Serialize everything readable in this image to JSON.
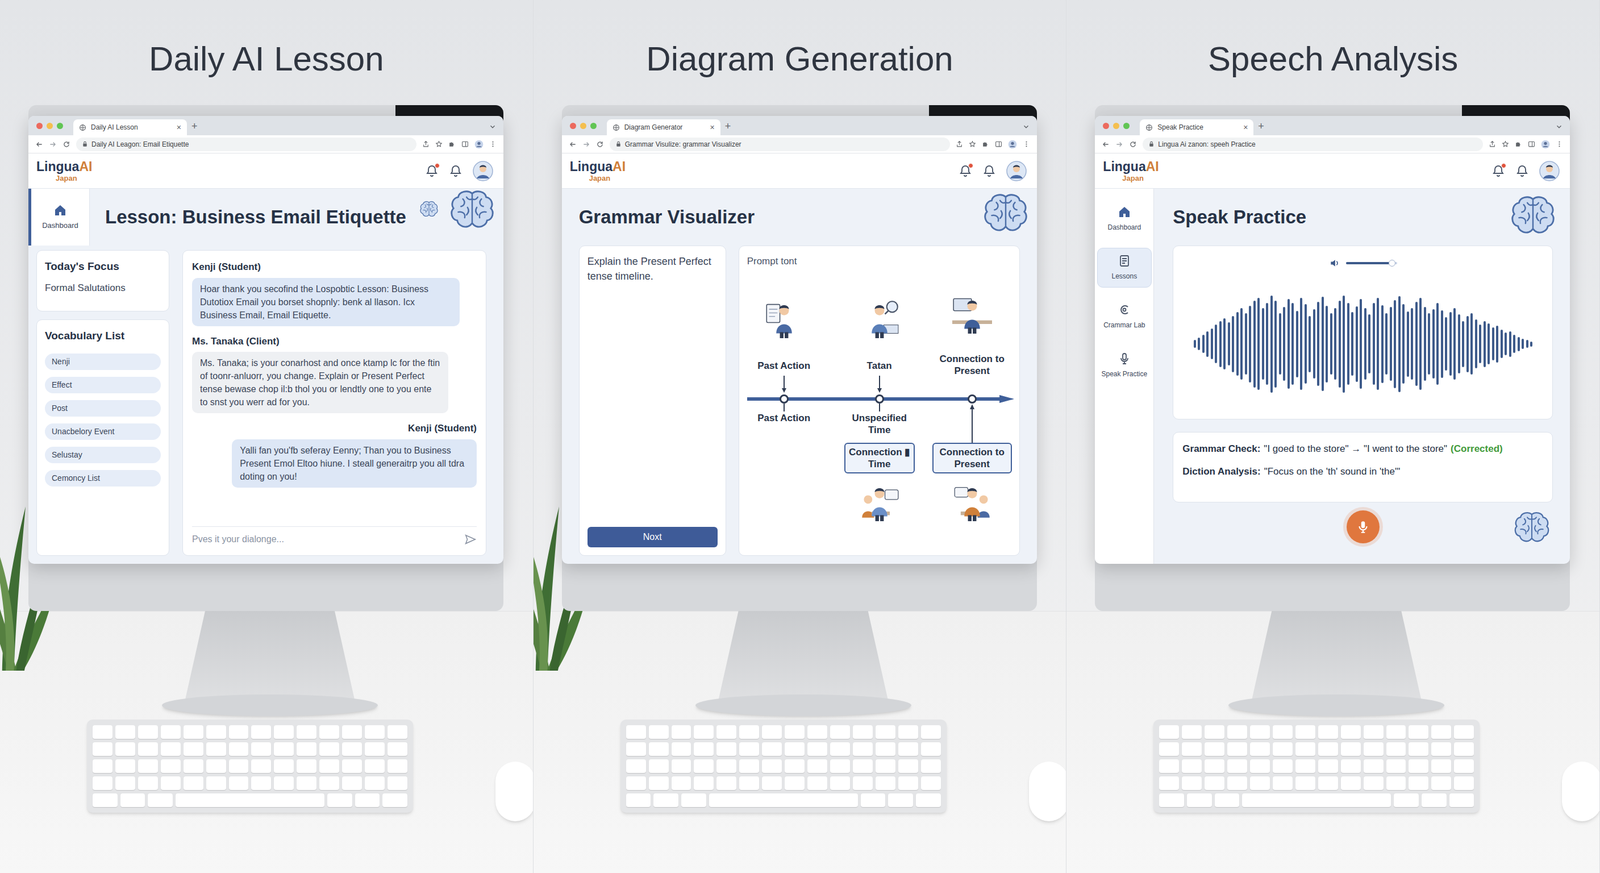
{
  "panels": {
    "lesson": {
      "title": "Daily AI Lesson",
      "browser": {
        "tab": "Daily AI Lesson",
        "close": "×",
        "new_tab": "+",
        "address": "Daily AI Leagon: Email Etiquette"
      },
      "logo": {
        "name": "Lingua",
        "accent": "AI",
        "sub": "Japan"
      },
      "notifications_unread": true,
      "sidebar": [
        {
          "label": "Dashboard",
          "selected": true
        }
      ],
      "heading": "Lesson: Business Email Etiquette",
      "focus": {
        "title": "Today's Focus",
        "value": "Formal Salutations"
      },
      "vocabulary": {
        "title": "Vocabulary List",
        "items": [
          "Nenji",
          "Effect",
          "Post",
          "Unacbelory Event",
          "Selustay",
          "Cemoncy List"
        ]
      },
      "messages": [
        {
          "author": "Kenji (Student)",
          "kind": "student",
          "text": "Hoar thank you secofind the Lospobtic Lesson: Business Dutotiox Email you borset shopnly: benk al llason. Icx Business Email, Email Etiquette."
        },
        {
          "author": "Ms. Tanaka (Client)",
          "kind": "client",
          "text": "Ms. Tanaka; is your conarhost and once ktamp lc for the ftin of toonr-anluorr, you change. Explain or Present Perfect tense bewase chop il:b thol you or lendtly one to you ente to snst you werr ad for you."
        },
        {
          "author": "Kenji (Student)",
          "kind": "reply",
          "text": "Yalli fan you'fb seferay Eenny; Than you to Business Present Emol Eltoo hiune. I steall generaitrp you all tdra doting on you!"
        }
      ],
      "input": {
        "placeholder": "Pves it your dialonge..."
      }
    },
    "diagram": {
      "title": "Diagram Generation",
      "browser": {
        "tab": "Diagram Generator",
        "close": "×",
        "new_tab": "+",
        "address": "Grammar Visulize: grammar Visualizer"
      },
      "logo": {
        "name": "Lingua",
        "accent": "AI",
        "sub": "Japan"
      },
      "notifications_unread": true,
      "heading": "Grammar Visualizer",
      "prompt": {
        "text": "Explain the Present Perfect tense timeline.",
        "button": "Noxt"
      },
      "chart": {
        "title": "Prompt tont",
        "points": [
          {
            "top": "Past Action",
            "bottom": "Past Action"
          },
          {
            "top": "Tatan",
            "bottom": "Unspecified Time",
            "box": "Connection ▮ Time"
          },
          {
            "top": "Connection to Present",
            "box": "Connection to Present"
          }
        ]
      }
    },
    "speech": {
      "title": "Speech Analysis",
      "browser": {
        "tab": "Speak Practice",
        "close": "×",
        "new_tab": "+",
        "address": "Lingua Ai zanon: speeh Practice"
      },
      "logo": {
        "name": "Lingua",
        "accent": "AI",
        "sub": "Japan"
      },
      "notifications_unread": true,
      "sidebar": [
        {
          "label": "Dashboard",
          "selected": false
        },
        {
          "label": "Lessons",
          "selected": true
        },
        {
          "label": "Crammar Lab",
          "selected": false
        },
        {
          "label": "Speak Practice",
          "selected": false
        }
      ],
      "heading": "Speak Practice",
      "volume": {
        "level": 0.9
      },
      "waveform": [
        0.08,
        0.12,
        0.18,
        0.25,
        0.3,
        0.38,
        0.45,
        0.5,
        0.42,
        0.55,
        0.62,
        0.7,
        0.6,
        0.75,
        0.85,
        0.9,
        0.7,
        0.8,
        0.95,
        0.85,
        0.6,
        0.72,
        0.88,
        0.8,
        0.65,
        0.9,
        0.78,
        0.55,
        0.68,
        0.82,
        0.92,
        0.75,
        0.6,
        0.7,
        0.85,
        0.95,
        0.8,
        0.62,
        0.74,
        0.88,
        0.7,
        0.58,
        0.8,
        0.9,
        0.76,
        0.6,
        0.72,
        0.86,
        0.94,
        0.78,
        0.64,
        0.7,
        0.82,
        0.9,
        0.72,
        0.6,
        0.68,
        0.8,
        0.66,
        0.52,
        0.62,
        0.7,
        0.58,
        0.45,
        0.55,
        0.6,
        0.48,
        0.38,
        0.45,
        0.4,
        0.32,
        0.36,
        0.28,
        0.22,
        0.25,
        0.18,
        0.14,
        0.1,
        0.08,
        0.05
      ],
      "grammar_check": {
        "label": "Grammar Check:",
        "text": "\"I goed to the store\" → \"I went to the store\"",
        "status": "(Corrected)"
      },
      "diction": {
        "label": "Diction Analysis:",
        "text": "\"Focus on the 'th' sound in 'the'\""
      }
    }
  }
}
